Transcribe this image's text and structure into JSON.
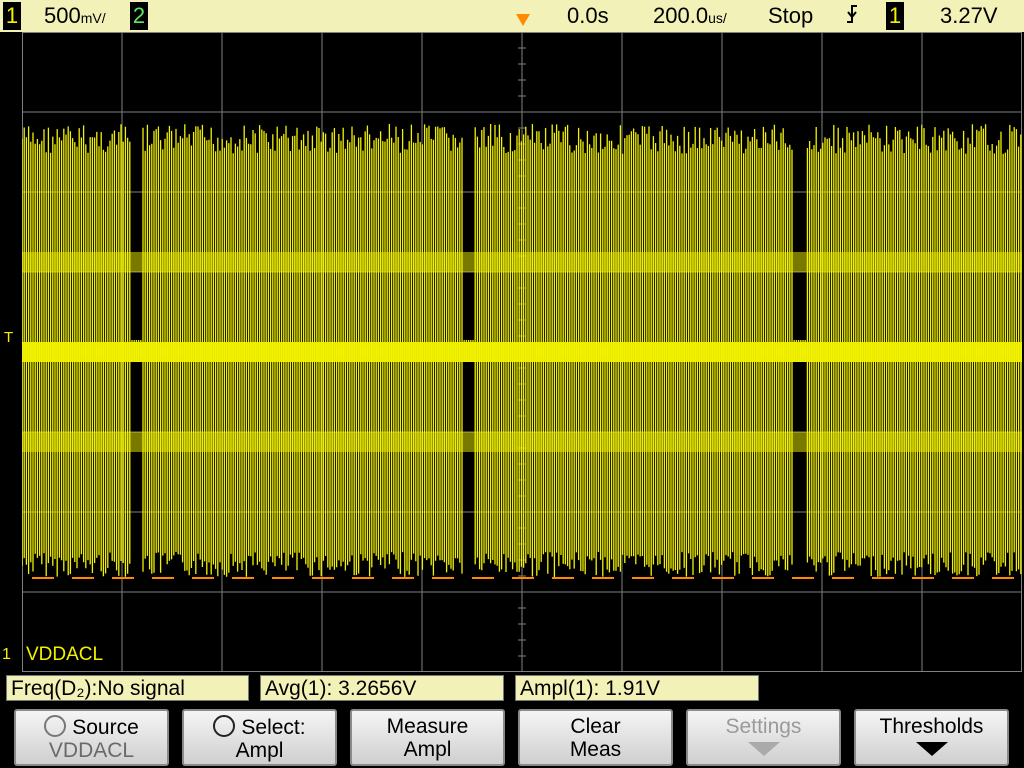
{
  "status_bar": {
    "ch1_num": "1",
    "ch1_scale": "500",
    "ch1_scale_unit": "mV/",
    "ch2_num": "2",
    "delay": "0.0s",
    "timebase": "200.0",
    "timebase_unit": "us/",
    "run_state": "Stop",
    "trigger_slope_icon": "falling-edge-icon",
    "trigger_source": "1",
    "trigger_level": "3.27V"
  },
  "screen": {
    "trigger_marker": "T",
    "channel_marker": "1",
    "channel_label": "VDDACL"
  },
  "measurements": {
    "freq": "Freq(D₂):No signal",
    "avg": "Avg(1): 3.2656V",
    "ampl": "Ampl(1): 1.91V"
  },
  "softkeys": {
    "source_title": "Source",
    "source_value": "VDDACL",
    "select_title": "Select:",
    "select_value": "Ampl",
    "measure_title": "Measure",
    "measure_value": "Ampl",
    "clear_title": "Clear",
    "clear_value": "Meas",
    "settings_title": "Settings",
    "thresholds_title": "Thresholds"
  },
  "colors": {
    "trace": "#f2f200",
    "status_bar_bg": "#f2f1b8",
    "trigger_marker": "#ff8a00",
    "grid": "#808080"
  }
}
